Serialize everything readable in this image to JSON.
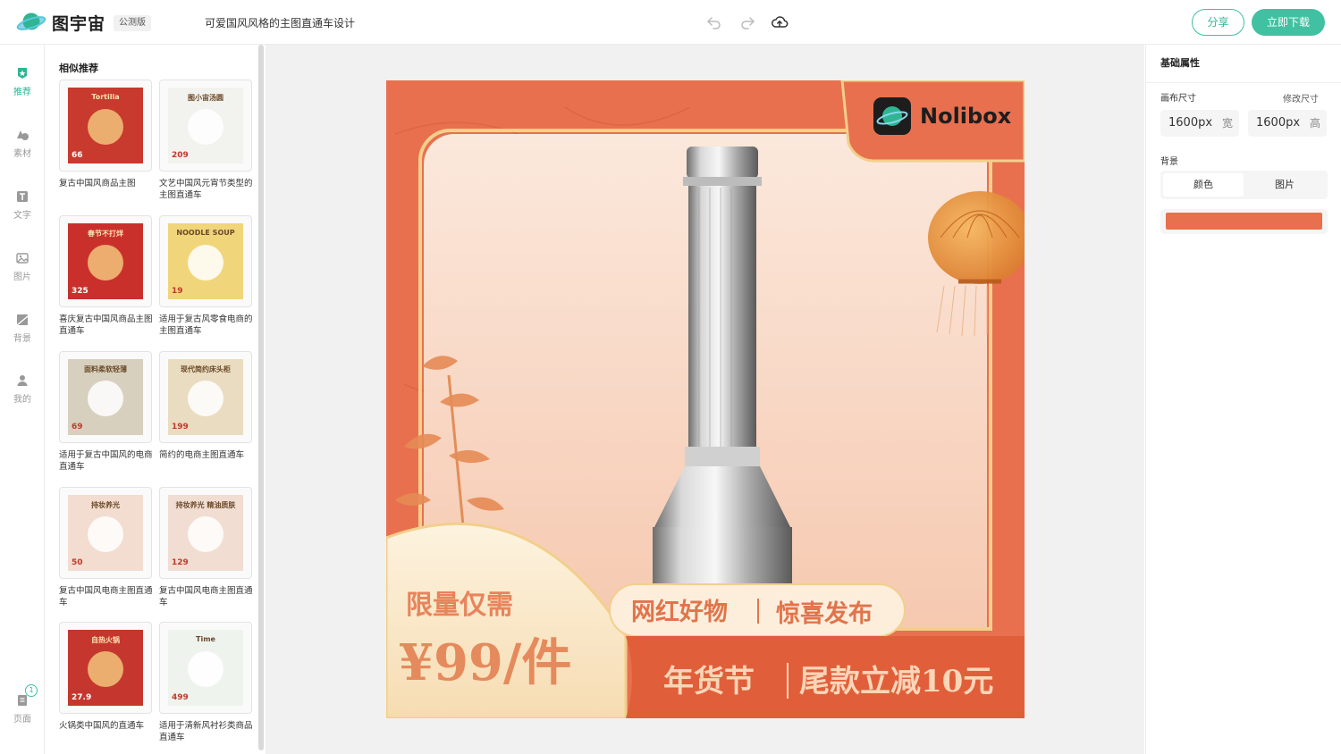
{
  "app": {
    "logo_text": "图宇宙",
    "badge": "公测版",
    "doc_title": "可爱国风风格的主图直通车设计",
    "share_label": "分享",
    "download_label": "立即下载"
  },
  "nav": {
    "items": [
      {
        "label": "推荐",
        "icon": "star-shield-icon"
      },
      {
        "label": "素材",
        "icon": "shapes-icon"
      },
      {
        "label": "文字",
        "icon": "text-icon"
      },
      {
        "label": "图片",
        "icon": "image-icon"
      },
      {
        "label": "背景",
        "icon": "background-icon"
      },
      {
        "label": "我的",
        "icon": "user-icon"
      }
    ],
    "pages_label": "页面",
    "pages_count": "1"
  },
  "panel": {
    "title": "相似推荐",
    "templates": [
      {
        "label": "复古中国风商品主图",
        "thumb_text": "Tortilla",
        "price": "66",
        "color": "#c8392e"
      },
      {
        "label": "文艺中国风元宵节类型的主图直通车",
        "thumb_text": "图小宙汤圆",
        "price": "209",
        "color": "#f2f2ee"
      },
      {
        "label": "喜庆复古中国风商品主图直通车",
        "thumb_text": "春节不打烊",
        "price": "325",
        "color": "#c9302c"
      },
      {
        "label": "适用于复古风零食电商的主图直通车",
        "thumb_text": "NOODLE SOUP",
        "price": "19",
        "color": "#f1d57a"
      },
      {
        "label": "适用于复古中国风的电商直通车",
        "thumb_text": "面料柔软轻薄",
        "price": "69",
        "color": "#d7d0bf"
      },
      {
        "label": "简约的电商主图直通车",
        "thumb_text": "现代简约床头柜",
        "price": "199",
        "color": "#e9dcc0"
      },
      {
        "label": "复古中国风电商主图直通车",
        "thumb_text": "持妆养光",
        "price": "50",
        "color": "#f3dcd0"
      },
      {
        "label": "复古中国风电商主图直通车",
        "thumb_text": "持妆养光 精油质肤",
        "price": "129",
        "color": "#f1ddd2"
      },
      {
        "label": "火锅类中国风的直通车",
        "thumb_text": "自热火锅",
        "price": "27.9",
        "color": "#c5372e"
      },
      {
        "label": "适用于清新风衬衫类商品直通车",
        "thumb_text": "Time",
        "price": "499",
        "color": "#eef3ee"
      }
    ]
  },
  "artboard": {
    "brand": "Nolibox",
    "promo_label": "限量仅需",
    "price": "¥99/件",
    "tagline_left": "网红好物",
    "tagline_right": "惊喜发布",
    "banner_left": "年货节",
    "banner_right": "尾款立减10元",
    "bg_color": "#e8704e"
  },
  "props": {
    "title": "基础属性",
    "canvas_size_label": "画布尺寸",
    "edit_size_label": "修改尺寸",
    "width_value": "1600px",
    "width_unit": "宽",
    "height_value": "1600px",
    "height_unit": "高",
    "background_label": "背景",
    "tab_color": "颜色",
    "tab_image": "图片",
    "background_color": "#e8704e"
  }
}
